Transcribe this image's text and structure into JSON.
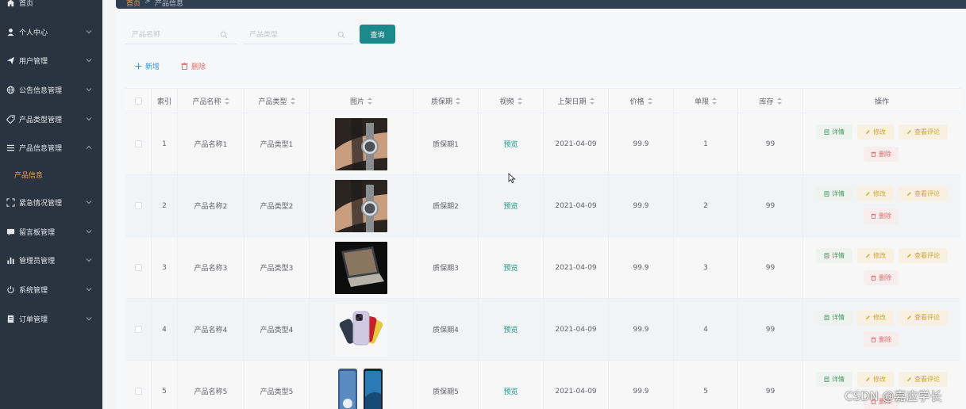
{
  "sidebar": {
    "items": [
      {
        "label": "首页",
        "icon": "home-icon"
      },
      {
        "label": "个人中心",
        "icon": "user-icon"
      },
      {
        "label": "用户管理",
        "icon": "send-icon"
      },
      {
        "label": "公告信息管理",
        "icon": "globe-icon"
      },
      {
        "label": "产品类型管理",
        "icon": "tag-icon"
      },
      {
        "label": "产品信息管理",
        "icon": "list-icon"
      },
      {
        "label": "紧急情况管理",
        "icon": "expand-icon"
      },
      {
        "label": "留言板管理",
        "icon": "message-icon"
      },
      {
        "label": "管理员管理",
        "icon": "bar-chart-icon"
      },
      {
        "label": "系统管理",
        "icon": "power-icon"
      },
      {
        "label": "订单管理",
        "icon": "document-icon"
      }
    ],
    "active_sub": "产品信息"
  },
  "breadcrumb": {
    "home": "首页",
    "separator": ">",
    "current": "产品信息"
  },
  "search": {
    "name_placeholder": "产品名称",
    "type_placeholder": "产品类型",
    "query_label": "查询"
  },
  "actions": {
    "add_label": "新增",
    "delete_label": "删除"
  },
  "table": {
    "headers": {
      "index": "索引",
      "name": "产品名称",
      "type": "产品类型",
      "image": "图片",
      "warranty": "质保期",
      "video": "视频",
      "date": "上架日期",
      "price": "价格",
      "limit": "单限",
      "stock": "库存",
      "ops": "操作"
    },
    "op_labels": {
      "detail": "详情",
      "edit": "修改",
      "review": "查看评论",
      "remove": "删除"
    },
    "rows": [
      {
        "index": "1",
        "name": "产品名称1",
        "type": "产品类型1",
        "image": "watch",
        "warranty": "质保期1",
        "video": "预览",
        "date": "2021-04-09",
        "price": "99.9",
        "limit": "1",
        "stock": "99"
      },
      {
        "index": "2",
        "name": "产品名称2",
        "type": "产品类型2",
        "image": "watch",
        "warranty": "质保期2",
        "video": "预览",
        "date": "2021-04-09",
        "price": "99.9",
        "limit": "2",
        "stock": "99"
      },
      {
        "index": "3",
        "name": "产品名称3",
        "type": "产品类型3",
        "image": "laptop",
        "warranty": "质保期3",
        "video": "预览",
        "date": "2021-04-09",
        "price": "99.9",
        "limit": "3",
        "stock": "99"
      },
      {
        "index": "4",
        "name": "产品名称4",
        "type": "产品类型4",
        "image": "phones",
        "warranty": "质保期4",
        "video": "预览",
        "date": "2021-04-09",
        "price": "99.9",
        "limit": "4",
        "stock": "99"
      },
      {
        "index": "5",
        "name": "产品名称5",
        "type": "产品类型5",
        "image": "phone-pair",
        "warranty": "质保期5",
        "video": "预览",
        "date": "2021-04-09",
        "price": "99.9",
        "limit": "5",
        "stock": "99"
      }
    ]
  },
  "watermark": "CSDN @嘉应学长",
  "colors": {
    "sidebar_bg": "#2a3441",
    "accent_orange": "#f4a24b",
    "query_button": "#1a8a8a",
    "link_green": "#1a9a8a",
    "danger": "#e06c6c",
    "warning": "#d4a32b",
    "success": "#3c9a5f"
  }
}
